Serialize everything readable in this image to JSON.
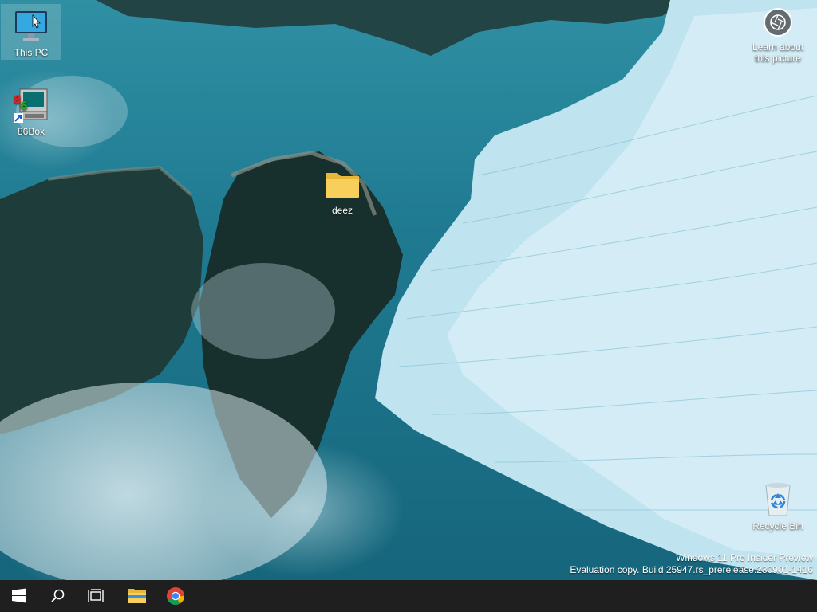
{
  "desktop": {
    "icons": [
      {
        "label": "This PC"
      },
      {
        "label": "86Box"
      },
      {
        "label": "deez"
      },
      {
        "label": "Recycle Bin"
      }
    ],
    "learn_about": {
      "line1": "Learn about",
      "line2": "this picture"
    },
    "watermark": {
      "line1": "Windows 11 Pro Insider Preview",
      "line2": "Evaluation copy. Build 25947.rs_prerelease.230901-1416"
    }
  },
  "taskbar": {
    "buttons": [
      {
        "icon": "windows-start-icon"
      },
      {
        "icon": "search-icon"
      },
      {
        "icon": "task-view-icon"
      },
      {
        "icon": "file-explorer-icon"
      },
      {
        "icon": "chrome-icon"
      }
    ],
    "colors": {
      "background": "#1f1f1f",
      "folder": "#f2c94c"
    }
  }
}
